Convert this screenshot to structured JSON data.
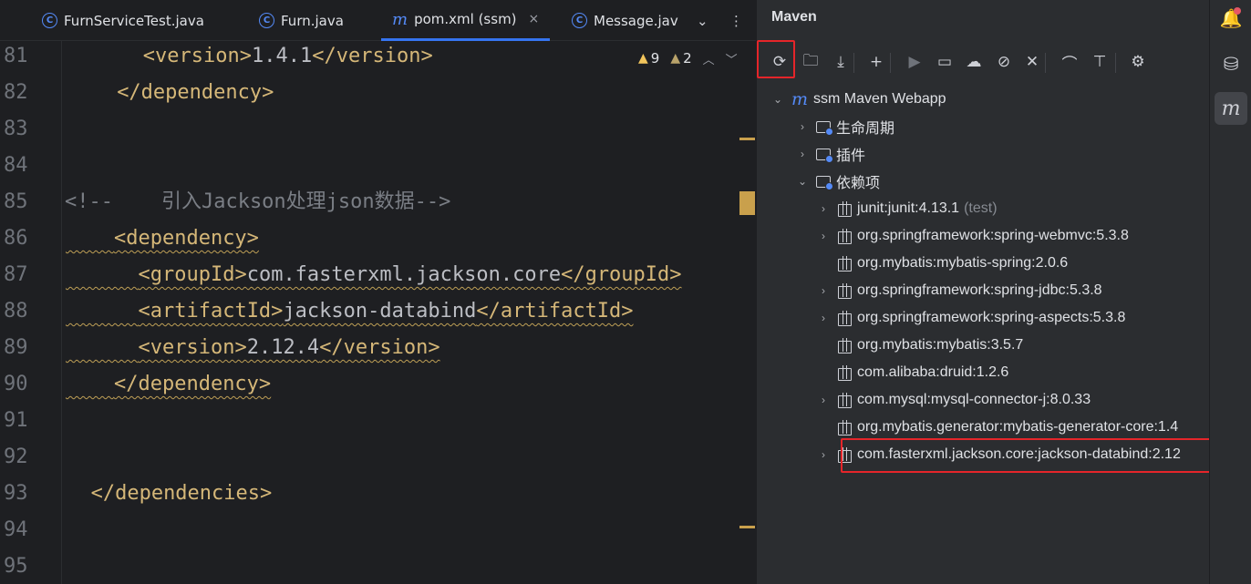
{
  "editor": {
    "tabs": [
      {
        "label": "FurnServiceTest.java",
        "icon": "java-class-icon"
      },
      {
        "label": "Furn.java",
        "icon": "java-class-icon"
      },
      {
        "label": "pom.xml (ssm)",
        "icon": "maven-icon",
        "active": true,
        "close": "×"
      },
      {
        "label": "Message.jav",
        "icon": "java-class-icon"
      }
    ],
    "tab_overflow": "⌄",
    "tab_menu": "⋮",
    "inspection": {
      "warnings": "9",
      "weak_warnings": "2",
      "up": "︿",
      "down": "﹀"
    },
    "lines": [
      {
        "no": "81",
        "segments": [
          [
            "tag",
            "<version>"
          ],
          [
            "txt",
            "1.4.1"
          ],
          [
            "tag",
            "</version>"
          ]
        ],
        "indent": 3
      },
      {
        "no": "82",
        "segments": [
          [
            "tag",
            "</dependency>"
          ]
        ],
        "indent": 2
      },
      {
        "no": "83",
        "segments": [],
        "indent": 0
      },
      {
        "no": "84",
        "segments": [],
        "indent": 0
      },
      {
        "no": "85",
        "segments": [
          [
            "cmt",
            "<!--    引入Jackson处理json数据-->"
          ]
        ],
        "indent": 0
      },
      {
        "no": "86",
        "segments": [
          [
            "tag",
            "<dependency>"
          ]
        ],
        "indent": 2,
        "squiggle": true
      },
      {
        "no": "87",
        "segments": [
          [
            "tag",
            "<groupId>"
          ],
          [
            "txt",
            "com.fasterxml.jackson.core"
          ],
          [
            "tag",
            "</groupId>"
          ]
        ],
        "indent": 3,
        "squiggle": true
      },
      {
        "no": "88",
        "segments": [
          [
            "tag",
            "<artifactId>"
          ],
          [
            "txt",
            "jackson-databind"
          ],
          [
            "tag",
            "</artifactId>"
          ]
        ],
        "indent": 3,
        "squiggle": true
      },
      {
        "no": "89",
        "segments": [
          [
            "tag",
            "<version>"
          ],
          [
            "txt",
            "2.12.4"
          ],
          [
            "tag",
            "</version>"
          ]
        ],
        "indent": 3,
        "squiggle": true
      },
      {
        "no": "90",
        "segments": [
          [
            "tag",
            "</dependency>"
          ]
        ],
        "indent": 2,
        "squiggle": true
      },
      {
        "no": "91",
        "segments": [],
        "indent": 0
      },
      {
        "no": "92",
        "segments": [],
        "indent": 0
      },
      {
        "no": "93",
        "segments": [
          [
            "tag",
            "</dependencies>"
          ]
        ],
        "indent": 1
      },
      {
        "no": "94",
        "segments": [],
        "indent": 0
      },
      {
        "no": "95",
        "segments": [],
        "indent": 0
      }
    ]
  },
  "maven": {
    "title": "Maven",
    "toolbar": [
      {
        "name": "reload-all-projects-icon",
        "glyph": "⟳",
        "highlighted": true
      },
      {
        "name": "generate-sources-icon",
        "glyph": "🗀"
      },
      {
        "name": "download-sources-icon",
        "glyph": "⤓"
      },
      {
        "name": "add-project-icon",
        "glyph": "+"
      },
      {
        "name": "run-goal-icon",
        "glyph": "▶",
        "dim": true
      },
      {
        "name": "execute-goal-icon",
        "glyph": "▭"
      },
      {
        "name": "offline-mode-icon",
        "glyph": "☁"
      },
      {
        "name": "skip-tests-icon",
        "glyph": "⊘"
      },
      {
        "name": "collapse-all-icon",
        "glyph": "✕"
      },
      {
        "name": "show-dependencies-icon",
        "glyph": "⌒"
      },
      {
        "name": "toggle-profile-icon",
        "glyph": "⊤"
      },
      {
        "name": "settings-icon",
        "glyph": "⚙"
      }
    ],
    "root": {
      "label": "ssm Maven Webapp",
      "chevron": "⌄",
      "logo": "m"
    },
    "groups": [
      {
        "label": "生命周期",
        "chevron": "›"
      },
      {
        "label": "插件",
        "chevron": "›"
      },
      {
        "label": "依赖项",
        "chevron": "⌄"
      }
    ],
    "dependencies": [
      {
        "label": "junit:junit:4.13.1",
        "scope": "(test)",
        "expandable": true
      },
      {
        "label": "org.springframework:spring-webmvc:5.3.8",
        "expandable": true
      },
      {
        "label": "org.mybatis:mybatis-spring:2.0.6",
        "expandable": false
      },
      {
        "label": "org.springframework:spring-jdbc:5.3.8",
        "expandable": true
      },
      {
        "label": "org.springframework:spring-aspects:5.3.8",
        "expandable": true
      },
      {
        "label": "org.mybatis:mybatis:3.5.7",
        "expandable": false
      },
      {
        "label": "com.alibaba:druid:1.2.6",
        "expandable": false
      },
      {
        "label": "com.mysql:mysql-connector-j:8.0.33",
        "expandable": true
      },
      {
        "label": "org.mybatis.generator:mybatis-generator-core:1.4",
        "expandable": false
      },
      {
        "label": "com.fasterxml.jackson.core:jackson-databind:2.12",
        "expandable": true,
        "highlighted": true
      }
    ],
    "chevron_collapsed": "›"
  },
  "strip": {
    "notifications": "🔔",
    "database": "⛁",
    "maven": "m"
  },
  "colors": {
    "highlight": "#e5252a",
    "accent": "#3574f0",
    "tag": "#d5b778",
    "text": "#bcbec4",
    "comment": "#7a7e85"
  }
}
